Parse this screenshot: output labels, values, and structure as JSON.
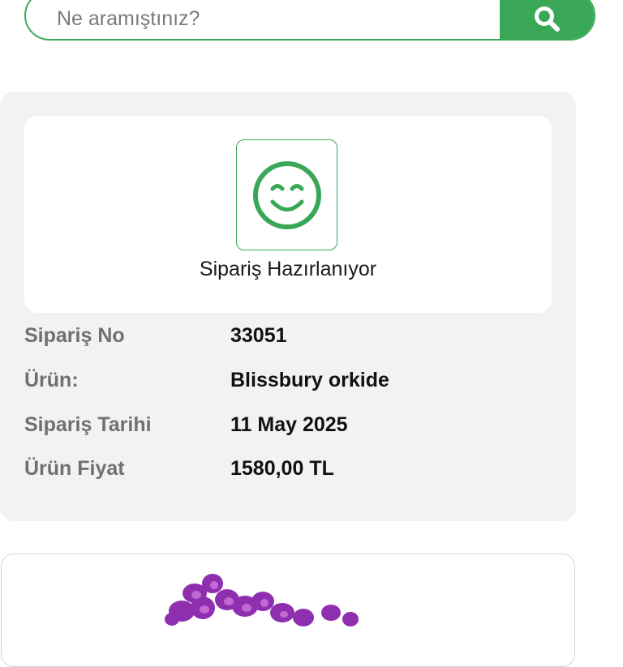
{
  "search": {
    "placeholder": "Ne aramıştınız?",
    "icon": "search-icon"
  },
  "status": {
    "icon": "smiley-face-icon",
    "label": "Sipariş Hazırlanıyor"
  },
  "details": [
    {
      "label": "Sipariş No",
      "value": "33051"
    },
    {
      "label": "Ürün:",
      "value": "Blissbury orkide"
    },
    {
      "label": "Sipariş Tarihi",
      "value": "11 May 2025"
    },
    {
      "label": "Ürün Fiyat",
      "value": "1580,00 TL"
    }
  ],
  "colors": {
    "accent": "#3aa757",
    "card_background": "#f2f2f2",
    "label_text": "#707070",
    "orchid_purple": "#8e2fb0"
  },
  "product": {
    "image": "purple-orchid-image"
  }
}
